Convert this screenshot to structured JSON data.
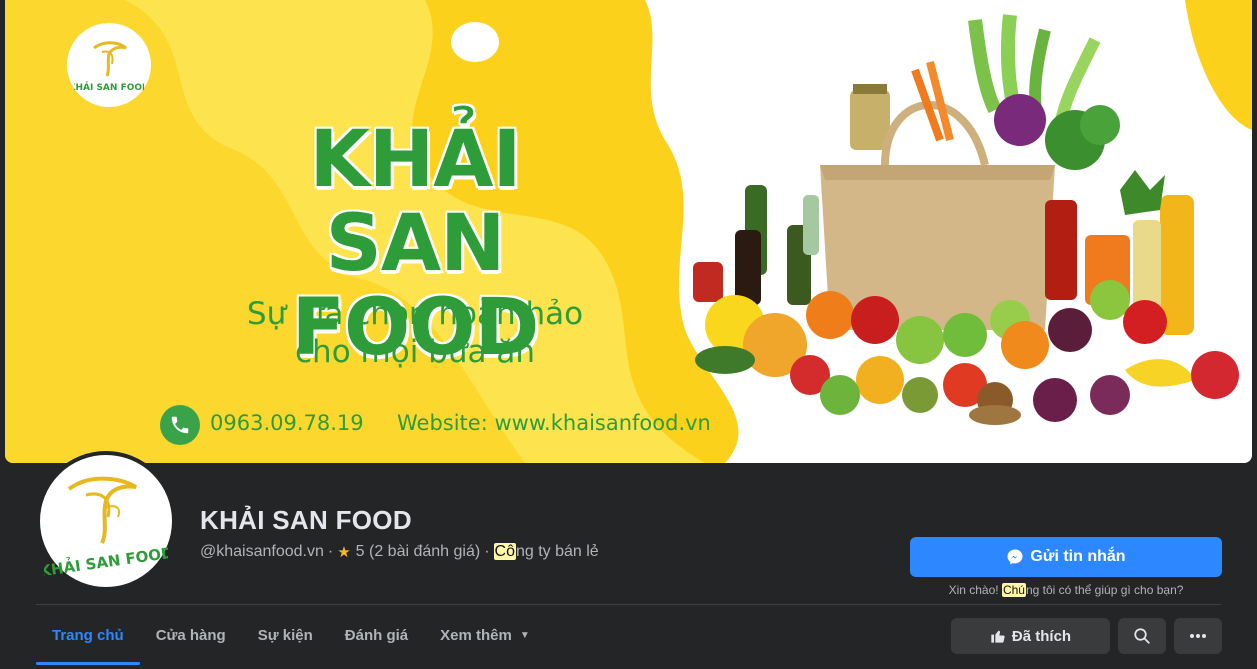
{
  "cover": {
    "brand_logo_text": "KHẢI SAN FOOD",
    "title_line1": "KHẢI SAN",
    "title_line2": "FOOD",
    "slogan_line1": "Sự lựa chọn hoàn hảo",
    "slogan_line2": "cho mọi bữa ăn",
    "phone": "0963.09.78.19",
    "website": "Website: www.khaisanfood.vn"
  },
  "profile": {
    "name": "KHẢI SAN FOOD",
    "handle": "@khaisanfood.vn",
    "separator": "·",
    "rating": "5 (2 bài đánh giá)",
    "category_highlight": "Cô",
    "category_rest": "ng ty bán lẻ"
  },
  "actions": {
    "message_label": "Gửi tin nhắn",
    "hint_prefix": "Xin chào! ",
    "hint_highlight": "Chú",
    "hint_rest": "ng tôi có thể giúp gì cho bạn?",
    "like_label": "Đã thích"
  },
  "tabs": [
    {
      "label": "Trang chủ",
      "active": true
    },
    {
      "label": "Cửa hàng",
      "active": false
    },
    {
      "label": "Sự kiện",
      "active": false
    },
    {
      "label": "Đánh giá",
      "active": false
    },
    {
      "label": "Xem thêm",
      "active": false
    }
  ],
  "icons": {
    "star": "star-icon",
    "messenger": "messenger-icon",
    "like": "thumbs-up-icon",
    "search": "search-icon",
    "more": "more-horizontal-icon",
    "phone": "phone-icon",
    "caret": "caret-down-icon"
  },
  "colors": {
    "accent": "#2d88ff",
    "background": "#242526",
    "cover_yellow": "#fcd11c",
    "brand_green": "#2f9c3a"
  }
}
